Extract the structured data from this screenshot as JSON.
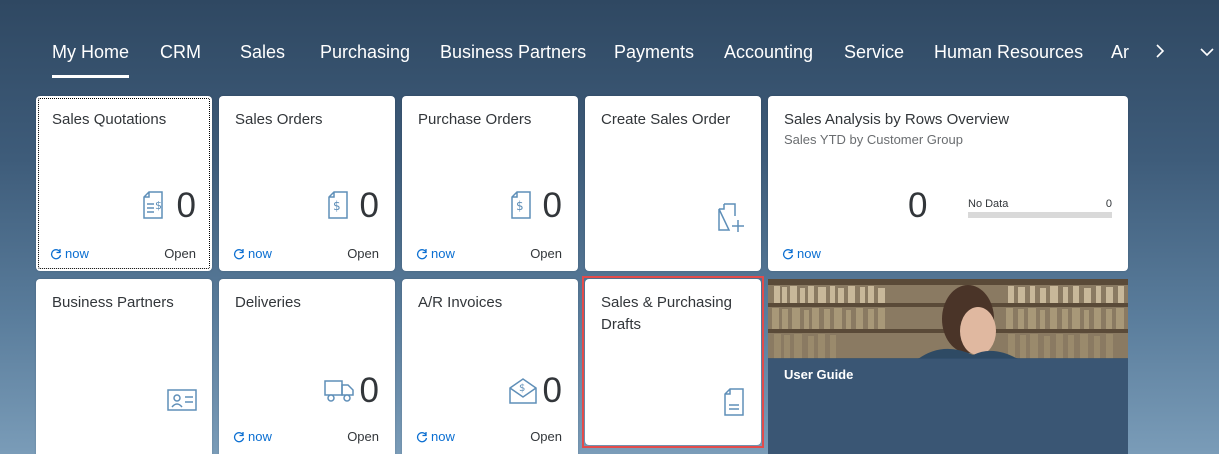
{
  "nav": {
    "items": [
      "My Home",
      "CRM",
      "Sales",
      "Purchasing",
      "Business Partners",
      "Payments",
      "Accounting",
      "Service",
      "Human Resources"
    ],
    "overflow_item": "Ar",
    "next_icon": "chevron-right-icon",
    "menu_icon": "chevron-down-icon"
  },
  "tiles": {
    "sales_quotations": {
      "title": "Sales Quotations",
      "value": "0",
      "refresh": "now",
      "status": "Open",
      "icon": "document-dollar-list-icon"
    },
    "sales_orders": {
      "title": "Sales Orders",
      "value": "0",
      "refresh": "now",
      "status": "Open",
      "icon": "document-dollar-icon"
    },
    "purchase_orders": {
      "title": "Purchase Orders",
      "value": "0",
      "refresh": "now",
      "status": "Open",
      "icon": "document-dollar-icon"
    },
    "create_sales_order": {
      "title": "Create Sales Order",
      "icon": "document-add-icon"
    },
    "sales_analysis": {
      "title": "Sales Analysis by Rows Overview",
      "subtitle": "Sales YTD by Customer Group",
      "value": "0",
      "bar_label": "No Data",
      "bar_value": "0",
      "refresh": "now"
    },
    "business_partners": {
      "title": "Business Partners",
      "icon": "id-card-icon"
    },
    "deliveries": {
      "title": "Deliveries",
      "value": "0",
      "refresh": "now",
      "status": "Open",
      "icon": "truck-icon"
    },
    "ar_invoices": {
      "title": "A/R Invoices",
      "value": "0",
      "refresh": "now",
      "status": "Open",
      "icon": "envelope-dollar-icon"
    },
    "sales_purchasing_drafts": {
      "title": "Sales & Purchasing Drafts",
      "icon": "document-text-icon"
    },
    "user_guide": {
      "title": "User Guide"
    }
  },
  "colors": {
    "accent": "#0a6ed1",
    "icon": "#5f8fb8",
    "highlight": "#e34b4b"
  }
}
